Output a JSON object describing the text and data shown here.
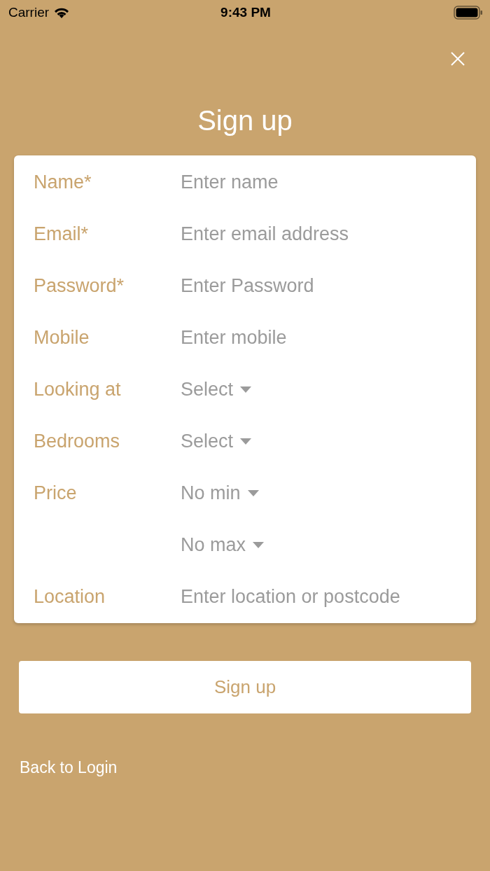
{
  "status_bar": {
    "carrier": "Carrier",
    "time": "9:43 PM"
  },
  "title": "Sign up",
  "form": [
    {
      "kind": "input",
      "label": "Name*",
      "placeholder": "Enter name"
    },
    {
      "kind": "input",
      "label": "Email*",
      "placeholder": "Enter email address"
    },
    {
      "kind": "input",
      "label": "Password*",
      "placeholder": "Enter Password"
    },
    {
      "kind": "input",
      "label": "Mobile",
      "placeholder": "Enter mobile"
    },
    {
      "kind": "select",
      "label": "Looking at",
      "value": "Select"
    },
    {
      "kind": "select",
      "label": "Bedrooms",
      "value": "Select"
    },
    {
      "kind": "select",
      "label": "Price",
      "value": "No min"
    },
    {
      "kind": "select",
      "value": "No max"
    },
    {
      "kind": "input",
      "label": "Location",
      "placeholder": "Enter location or postcode"
    }
  ],
  "submit": "Sign up",
  "back_link": "Back to Login"
}
